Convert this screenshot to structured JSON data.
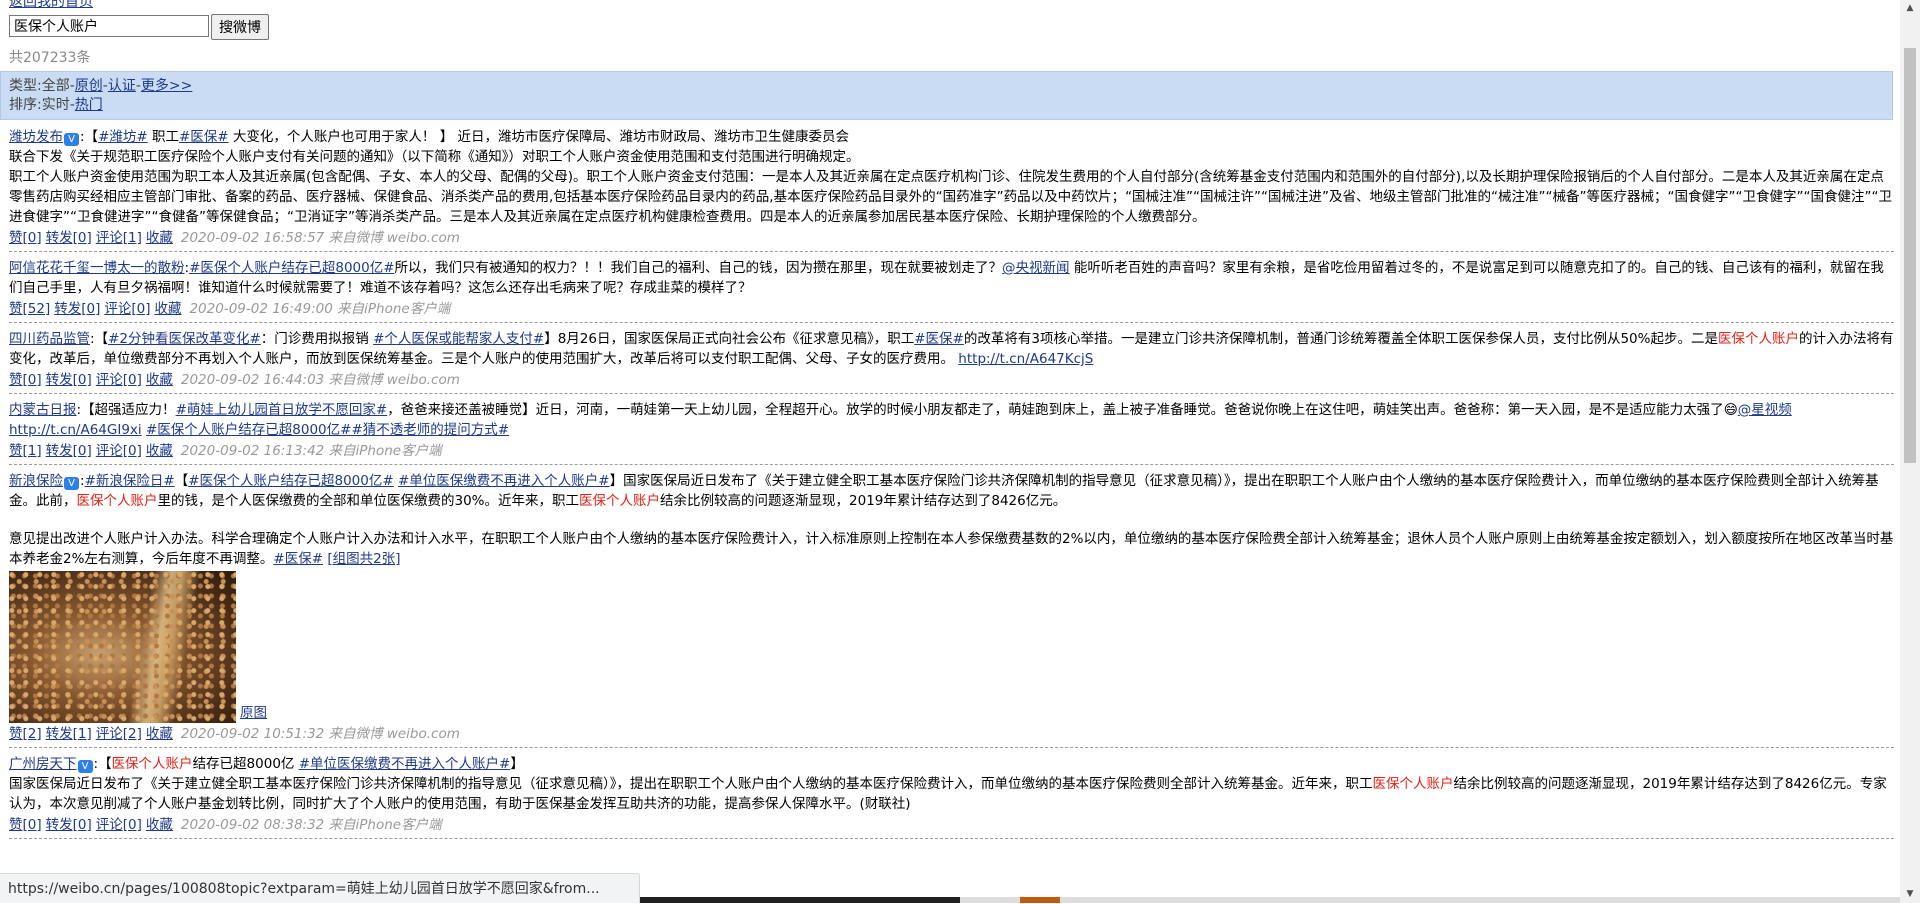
{
  "nav": {
    "back_link": "返回我的首页"
  },
  "search": {
    "value": "医保个人账户",
    "button": "搜微博"
  },
  "count_text": "共207233条",
  "filters": {
    "type_label": "类型:",
    "type_all": "全部",
    "sep": "-",
    "type_original": "原创",
    "type_verified": "认证",
    "type_more": "更多>>",
    "sort_label": "排序:",
    "sort_realtime": "实时",
    "sort_hot": "热门"
  },
  "posts": [
    {
      "author": "潍坊发布",
      "tag1": "#潍坊#",
      "t1": " 职工",
      "tag2": "#医保#",
      "t2": " 大变化，个人账户也可用于家人！ 】 近日，潍坊市医疗保障局、潍坊市财政局、潍坊市卫生健康委员会",
      "p2": "联合下发《关于规范职工医疗保险个人账户支付有关问题的通知》（以下简称《通知》）对职工个人账户资金使用范围和支付范围进行明确规定。",
      "p3": "职工个人账户资金使用范围为职工本人及其近亲属(包含配偶、子女、本人的父母、配偶的父母)。职工个人账户资金支付范围：一是本人及其近亲属在定点医疗机构门诊、住院发生费用的个人自付部分(含统筹基金支付范围内和范围外的自付部分),以及长期护理保险报销后的个人自付部分。二是本人及其近亲属在定点零售药店购买经相应主管部门审批、备案的药品、医疗器械、保健食品、消杀类产品的费用,包括基本医疗保险药品目录内的药品,基本医疗保险药品目录外的“国药准字”药品以及中药饮片；“国械注准”“国械注许”“国械注进”及省、地级主管部门批准的“械注准”“械备”等医疗器械；“国食健字”“卫食健字”“国食健注”“卫进食健字”“卫食健进字”“食健备”等保健食品；“卫消证字”等消杀类产品。三是本人及其近亲属在定点医疗机构健康检查费用。四是本人的近亲属参加居民基本医疗保险、长期护理保险的个人缴费部分。",
      "like": "赞[0]",
      "repost": "转发[0]",
      "comment": "评论[1]",
      "fav": "收藏",
      "time": "2020-09-02 16:58:57 来自微博 weibo.com"
    },
    {
      "author": "阿信花花千玺一博太一的散粉",
      "tag1": "#医保个人账户结存已超8000亿#",
      "t1": "所以，我们只有被通知的权力？！！我们自己的福利、自己的钱，因为攒在那里，现在就要被划走了？",
      "mention": "@央视新闻",
      "t2": " 能听听老百姓的声音吗？家里有余粮，是省吃俭用留着过冬的，不是说富足到可以随意克扣了的。自己的钱、自己该有的福利，就留在我们自己手里，人有旦夕祸福啊！谁知道什么时候就需要了！难道不该存着吗？这怎么还存出毛病来了呢？存成韭菜的模样了？",
      "like": "赞[52]",
      "repost": "转发[0]",
      "comment": "评论[0]",
      "fav": "收藏",
      "time": "2020-09-02 16:49:00 来自iPhone客户端"
    },
    {
      "author": "四川药品监管",
      "t0": "【",
      "tag1": "#2分钟看医保改革变化#",
      "t1": "：门诊费用拟报销 ",
      "tag2": "#个人医保或能帮家人支付#",
      "t2": "】8月26日，国家医保局正式向社会公布《征求意见稿》，职工",
      "tag3": "#医保#",
      "t3": "的改革将有3项核心举措。一是建立门诊共济保障机制，普通门诊统筹覆盖全体职工医保参保人员，支付比例从50%起步。二是",
      "hl": "医保个人账户",
      "t4": "的计入办法将有变化，改革后，单位缴费部分不再划入个人账户，而放到医保统筹基金。三是个人账户的使用范围扩大，改革后将可以支付职工配偶、父母、子女的医疗费用。",
      "url": "http://t.cn/A647KcjS",
      "like": "赞[0]",
      "repost": "转发[0]",
      "comment": "评论[0]",
      "fav": "收藏",
      "time": "2020-09-02 16:44:03 来自微博 weibo.com"
    },
    {
      "author": "内蒙古日报",
      "t0": "【超强适应力！",
      "tag1": "#萌娃上幼儿园首日放学不愿回家#",
      "t1": "，爸爸来接还盖被睡觉】近日，河南，一萌娃第一天上幼儿园，全程超开心。放学的时候小朋友都走了，萌娃跑到床上，盖上被子准备睡觉。爸爸说你晚上在这住吧，萌娃笑出声。爸爸称：第一天入园，是不是适应能力太强了",
      "mention": "@星视频",
      "url": "http://t.cn/A64GI9xi",
      "tag2": "#医保个人账户结存已超8000亿#",
      "tag3": "#猜不透老师的提问方式#",
      "like": "赞[1]",
      "repost": "转发[0]",
      "comment": "评论[0]",
      "fav": "收藏",
      "time": "2020-09-02 16:13:42 来自iPhone客户端"
    },
    {
      "author": "新浪保险",
      "tag0": "#新浪保险日#",
      "t0": "【",
      "tag1": "#医保个人账户结存已超8000亿#",
      "tag2": "#单位医保缴费不再进入个人账户#",
      "t1": "】国家医保局近日发布了《关于建立健全职工基本医疗保险门诊共济保障机制的指导意见（征求意见稿）》，提出在职职工个人账户由个人缴纳的基本医疗保险费计入，而单位缴纳的基本医疗保险费则全部计入统筹基金。此前，",
      "hl1": "医保个人账户",
      "t2": "里的钱，是个人医保缴费的全部和单位医保缴费的30%。近年来，职工",
      "hl2": "医保个人账户",
      "t3": "结余比例较高的问题逐渐显现，2019年累计结存达到了8426亿元。",
      "p2": "意见提出改进个人账户计入办法。科学合理确定个人账户计入办法和计入水平，在职职工个人账户由个人缴纳的基本医疗保险费计入，计入标准原则上控制在本人参保缴费基数的2%以内，单位缴纳的基本医疗保险费全部计入统筹基金；退休人员个人账户原则上由统筹基金按定额划入，划入额度按所在地区改革当时基本养老金2%左右测算，今后年度不再调整。",
      "tag3": "#医保#",
      "group": "[组图共2张]",
      "orig": "原图",
      "like": "赞[2]",
      "repost": "转发[1]",
      "comment": "评论[2]",
      "fav": "收藏",
      "time": "2020-09-02 10:51:32 来自微博 weibo.com"
    },
    {
      "author": "广州房天下",
      "t0": "【",
      "hl1": "医保个人账户",
      "t1": "结存已超8000亿 ",
      "tag1": "#单位医保缴费不再进入个人账户#",
      "t2": "】",
      "p2a": "国家医保局近日发布了《关于建立健全职工基本医疗保险门诊共济保障机制的指导意见（征求意见稿）》，提出在职职工个人账户由个人缴纳的基本医疗保险费计入，而单位缴纳的基本医疗保险费则全部计入统筹基金。近年来，职工",
      "hl2": "医保个人账户",
      "p2b": "结余比例较高的问题逐渐显现，2019年累计结存达到了8426亿元。专家认为，本次意见削减了个人账户基金划转比例，同时扩大了个人账户的使用范围，有助于医保基金发挥互助共济的功能，提高参保人保障水平。(财联社)",
      "like": "赞[0]",
      "repost": "转发[0]",
      "comment": "评论[0]",
      "fav": "收藏",
      "time": "2020-09-02 08:38:32 来自iPhone客户端"
    }
  ],
  "status_bar": {
    "url": "https://weibo.cn/pages/100808topic?extparam=萌娃上幼儿园首日放学不愿回家&from..."
  }
}
